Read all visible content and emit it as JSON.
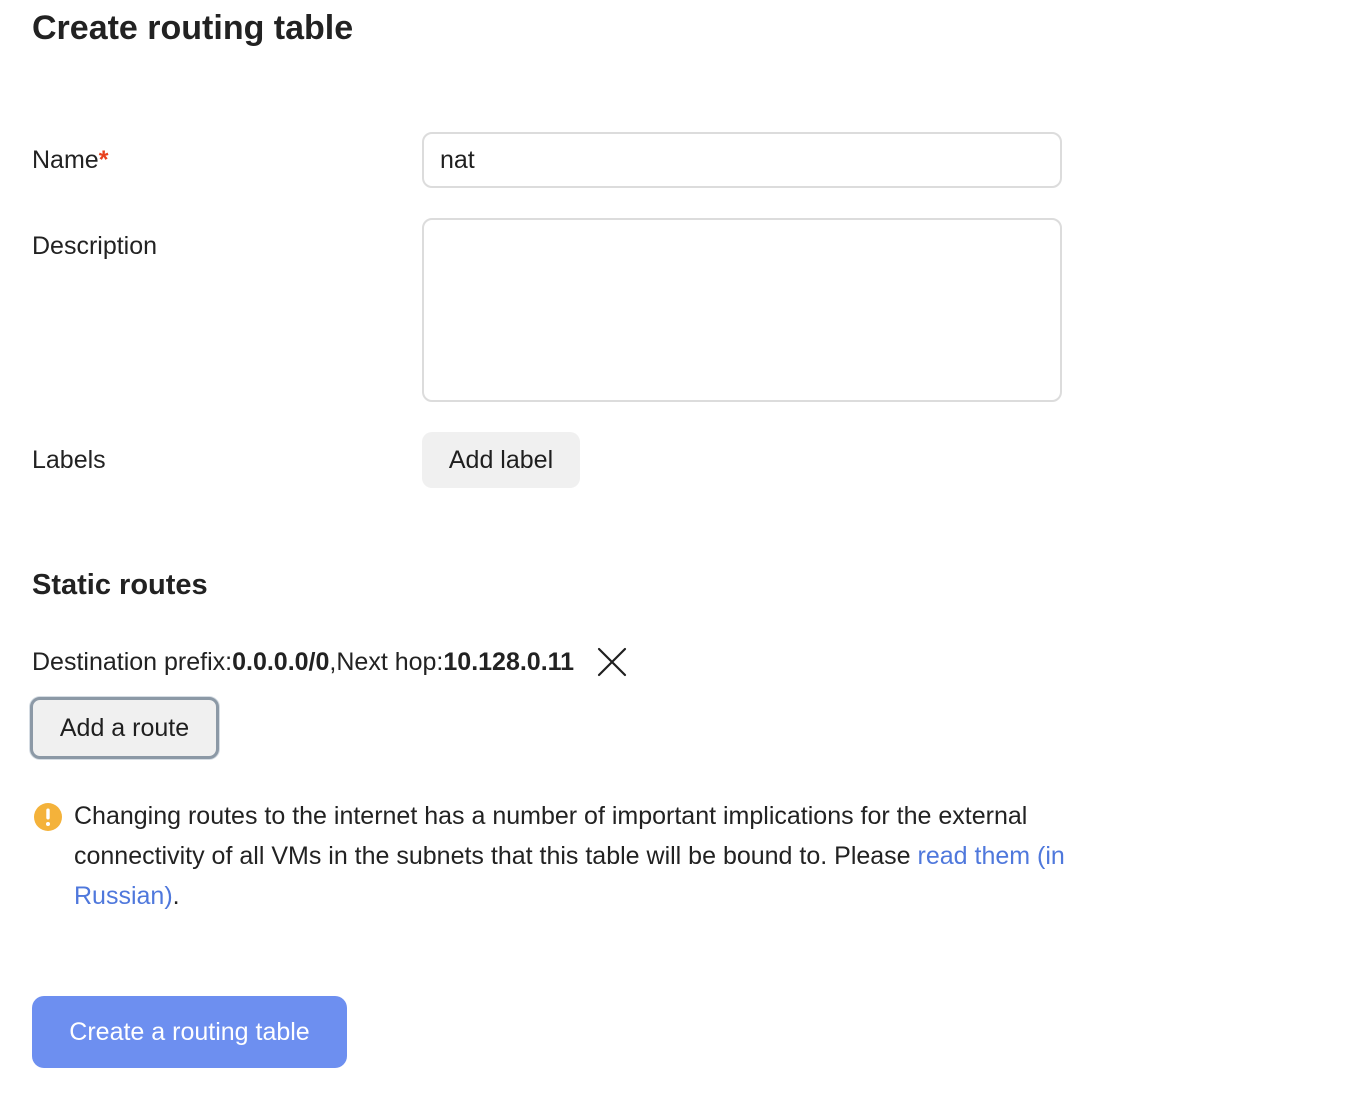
{
  "page": {
    "title": "Create routing table"
  },
  "form": {
    "name": {
      "label": "Name",
      "required_mark": "*",
      "value": "nat"
    },
    "description": {
      "label": "Description",
      "value": ""
    },
    "labels": {
      "label": "Labels",
      "add_button": "Add label"
    }
  },
  "static_routes": {
    "title": "Static routes",
    "routes": [
      {
        "prefix_label": "Destination prefix: ",
        "prefix_value": "0.0.0.0/0",
        "separator": ", ",
        "next_hop_label": "Next hop: ",
        "next_hop_value": "10.128.0.11"
      }
    ],
    "add_route_button": "Add a route"
  },
  "warning": {
    "icon": "exclamation-circle-icon",
    "text": "Changing routes to the internet has a number of important implications for the external connectivity of all VMs in the subnets that this table will be bound to. Please ",
    "link_text": "read them (in Russian)",
    "trailing": "."
  },
  "actions": {
    "create_button": "Create a routing table"
  },
  "colors": {
    "accent": "#6d8ff0",
    "link": "#4f78dc",
    "required": "#e8401c",
    "warning": "#f4b23a"
  }
}
